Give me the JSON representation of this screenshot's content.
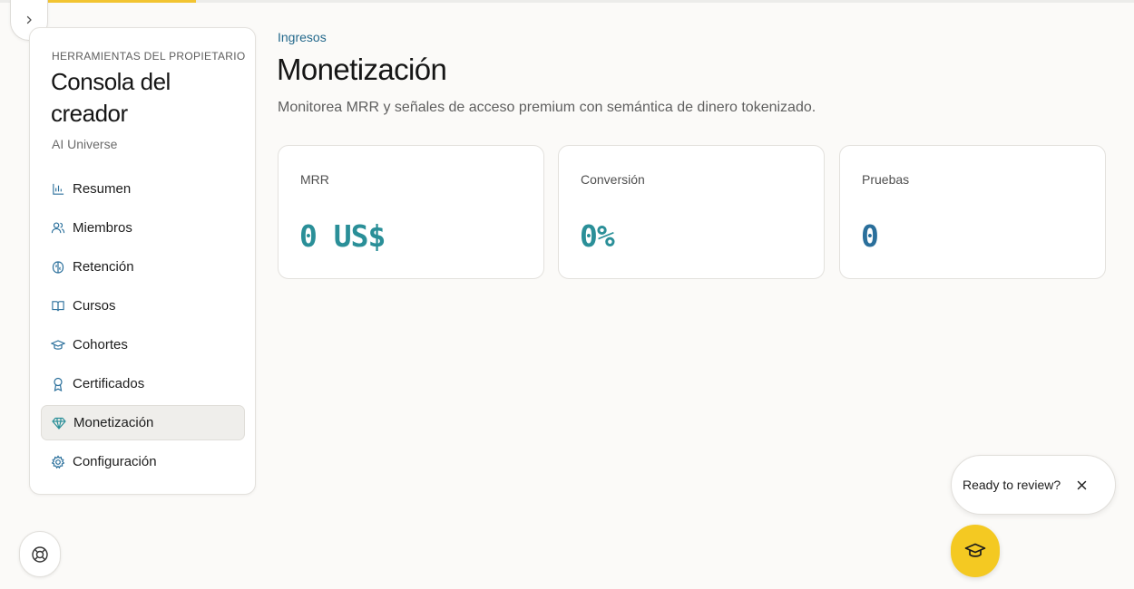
{
  "colors": {
    "accent_yellow": "#f4c922",
    "link_blue": "#24698c",
    "metric_teal": "#2a8f98",
    "metric_blue": "#2a6f9b"
  },
  "sidebar": {
    "kicker": "HERRAMIENTAS DEL PROPIETARIO",
    "title": "Consola del creador",
    "subtitle": "AI Universe",
    "items": [
      {
        "label": "Resumen",
        "icon": "bar-chart-icon"
      },
      {
        "label": "Miembros",
        "icon": "users-icon"
      },
      {
        "label": "Retención",
        "icon": "brain-icon"
      },
      {
        "label": "Cursos",
        "icon": "book-open-icon"
      },
      {
        "label": "Cohortes",
        "icon": "graduation-cap-icon"
      },
      {
        "label": "Certificados",
        "icon": "award-icon"
      },
      {
        "label": "Monetización",
        "icon": "gem-icon",
        "active": true
      },
      {
        "label": "Configuración",
        "icon": "gear-icon"
      }
    ]
  },
  "header": {
    "eyebrow": "Ingresos",
    "title": "Monetización",
    "description": "Monitorea MRR y señales de acceso premium con semántica de dinero tokenizado."
  },
  "metrics": [
    {
      "label": "MRR",
      "value": "0 US$"
    },
    {
      "label": "Conversión",
      "value": "0%"
    },
    {
      "label": "Pruebas",
      "value": "0"
    }
  ],
  "review_prompt": {
    "text": "Ready to review?"
  }
}
